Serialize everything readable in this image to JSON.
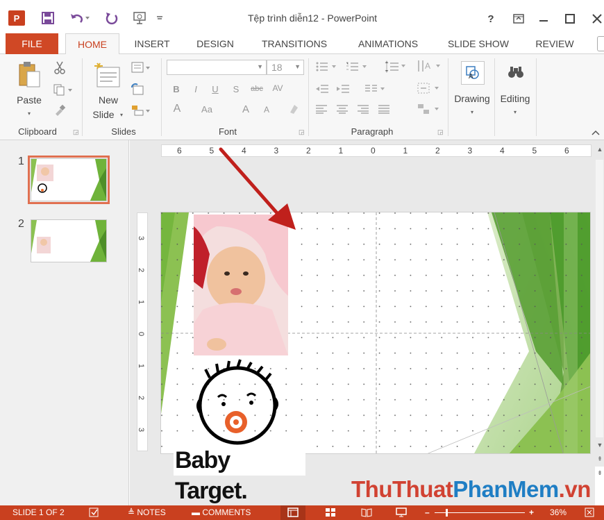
{
  "app": {
    "title": "Tệp trình diễn12 - PowerPoint",
    "icon_label": "P"
  },
  "tabs": {
    "file": "FILE",
    "home": "HOME",
    "insert": "INSERT",
    "design": "DESIGN",
    "transitions": "TRANSITIONS",
    "animations": "ANIMATIONS",
    "slideshow": "SLIDE SHOW",
    "review": "REVIEW"
  },
  "ribbon": {
    "clipboard": {
      "label": "Clipboard",
      "paste": "Paste"
    },
    "slides": {
      "label": "Slides",
      "new_slide_1": "New",
      "new_slide_2": "Slide"
    },
    "font": {
      "label": "Font",
      "size": "18",
      "bold": "B",
      "italic": "I",
      "underline": "U",
      "shadow": "S",
      "strike": "abc",
      "spacing": "AV",
      "color": "A",
      "case": "Aa",
      "grow": "A",
      "shrink": "A"
    },
    "paragraph": {
      "label": "Paragraph"
    },
    "drawing": {
      "label": "Drawing"
    },
    "editing": {
      "label": "Editing"
    }
  },
  "thumbnails": [
    {
      "number": "1"
    },
    {
      "number": "2"
    }
  ],
  "ruler": {
    "horizontal": [
      "6",
      "5",
      "4",
      "3",
      "2",
      "1",
      "0",
      "1",
      "2",
      "3",
      "4",
      "5",
      "6"
    ],
    "vertical": [
      "3",
      "2",
      "1",
      "0",
      "1",
      "2",
      "3"
    ]
  },
  "slide": {
    "logo_text": "Baby Target."
  },
  "statusbar": {
    "slide_info": "SLIDE 1 OF 2",
    "notes": "NOTES",
    "comments": "COMMENTS",
    "zoom": "36%"
  },
  "watermark": {
    "part1": "ThuThuat",
    "part2": "PhanMem",
    "part3": ".vn"
  },
  "colors": {
    "accent": "#c9401f",
    "slide_green": "#6fb33a",
    "arrow": "#c0201c"
  }
}
